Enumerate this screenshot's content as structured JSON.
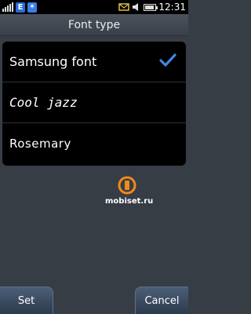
{
  "status_bar": {
    "network_badge": "E",
    "bluetooth_badge": "✶",
    "icons": [
      "signal-icon",
      "network-e-icon",
      "bluetooth-icon",
      "notification-icon",
      "speaker-icon",
      "battery-icon"
    ],
    "time": "12:31"
  },
  "header": {
    "title": "Font type"
  },
  "font_list": {
    "items": [
      {
        "label": "Samsung font",
        "selected": true
      },
      {
        "label": "Cool jazz",
        "selected": false
      },
      {
        "label": "Rosemary",
        "selected": false
      }
    ],
    "check_color": "#3f86e0"
  },
  "watermark": {
    "text": "mobiset.ru"
  },
  "softkeys": {
    "set_label": "Set",
    "cancel_label": "Cancel"
  }
}
